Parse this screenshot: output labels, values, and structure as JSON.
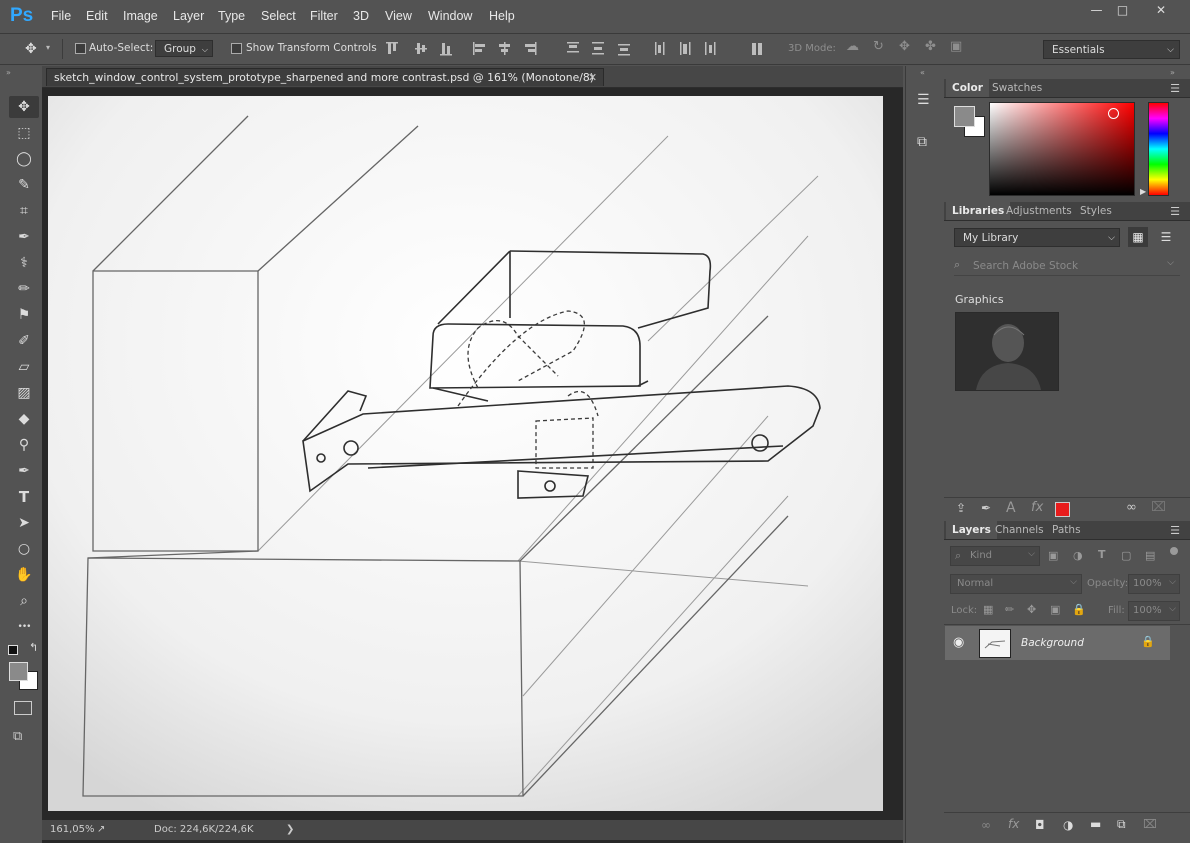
{
  "app": {
    "logo": "Ps"
  },
  "menu": [
    "File",
    "Edit",
    "Image",
    "Layer",
    "Type",
    "Select",
    "Filter",
    "3D",
    "View",
    "Window",
    "Help"
  ],
  "window_controls": {
    "minimize": "—",
    "maximize": "□",
    "close": "✕"
  },
  "options": {
    "auto_select_label": "Auto-Select:",
    "auto_select_checked": false,
    "auto_select_value": "Group",
    "show_transform_label": "Show Transform Controls",
    "mode_3d_label": "3D Mode:",
    "workspace": "Essentials"
  },
  "document": {
    "tab_title": "sketch_window_control_system_prototype_sharpened and more contrast.psd @ 161% (Monotone/8)",
    "zoom": "161,05%",
    "doc_info": "Doc: 224,6K/224,6K"
  },
  "tools": [
    {
      "name": "move-tool",
      "glyph": "✥"
    },
    {
      "name": "marquee-tool",
      "glyph": "⬚"
    },
    {
      "name": "lasso-tool",
      "glyph": "◯"
    },
    {
      "name": "quick-select-tool",
      "glyph": "✎"
    },
    {
      "name": "crop-tool",
      "glyph": "⌗"
    },
    {
      "name": "eyedropper-tool",
      "glyph": "✒"
    },
    {
      "name": "healing-brush-tool",
      "glyph": "⚕"
    },
    {
      "name": "brush-tool",
      "glyph": "✏"
    },
    {
      "name": "clone-stamp-tool",
      "glyph": "⚑"
    },
    {
      "name": "history-brush-tool",
      "glyph": "✐"
    },
    {
      "name": "eraser-tool",
      "glyph": "▱"
    },
    {
      "name": "gradient-tool",
      "glyph": "▨"
    },
    {
      "name": "blur-tool",
      "glyph": "◆"
    },
    {
      "name": "dodge-tool",
      "glyph": "⚲"
    },
    {
      "name": "pen-tool",
      "glyph": "✒"
    },
    {
      "name": "type-tool",
      "glyph": "T"
    },
    {
      "name": "path-select-tool",
      "glyph": "➤"
    },
    {
      "name": "ellipse-tool",
      "glyph": "○"
    },
    {
      "name": "hand-tool",
      "glyph": "✋"
    },
    {
      "name": "zoom-tool",
      "glyph": "⌕"
    },
    {
      "name": "more-tools",
      "glyph": "•••"
    }
  ],
  "panels": {
    "color_tabs": [
      "Color",
      "Swatches"
    ],
    "libraries_tabs": [
      "Libraries",
      "Adjustments",
      "Styles"
    ],
    "library_name": "My Library",
    "search_placeholder": "Search Adobe Stock",
    "graphics_label": "Graphics",
    "layers_tabs": [
      "Layers",
      "Channels",
      "Paths"
    ],
    "kind_label": "Kind",
    "blend_mode": "Normal",
    "opacity_label": "Opacity:",
    "opacity_value": "100%",
    "lock_label": "Lock:",
    "fill_label": "Fill:",
    "fill_value": "100%",
    "layers": [
      {
        "name": "Background",
        "locked": true,
        "visible": true
      }
    ]
  },
  "colors": {
    "foreground": "#8a8a8a",
    "background": "#ffffff",
    "accent_red": "#e81c1c"
  }
}
